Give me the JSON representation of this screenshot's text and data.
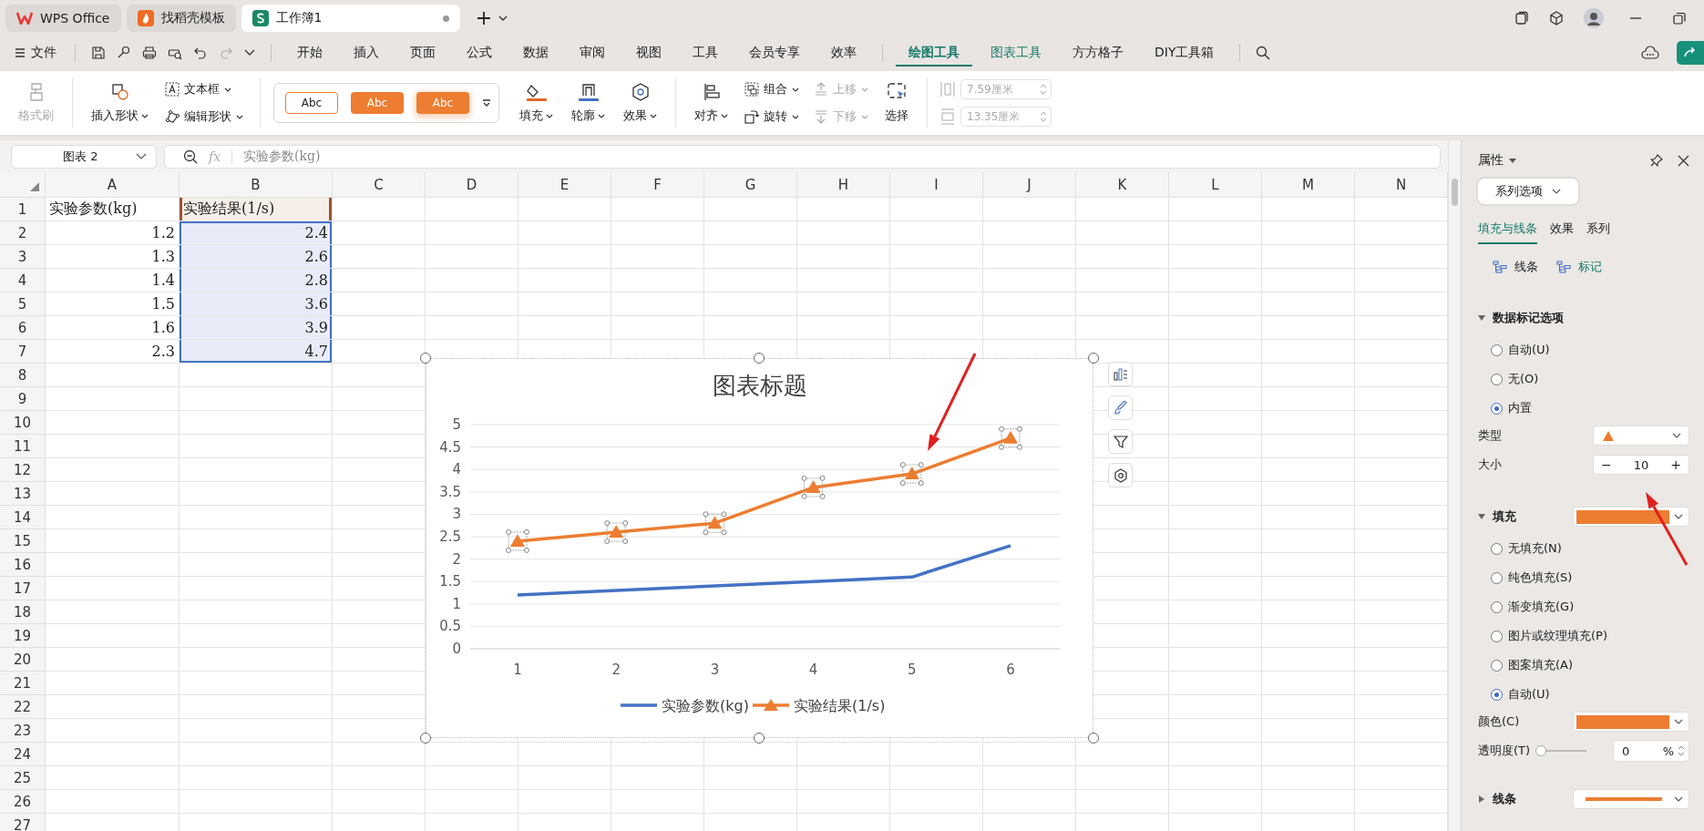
{
  "tabs": [
    {
      "label": "WPS Office",
      "selected": false
    },
    {
      "label": "找稻壳模板",
      "selected": false
    },
    {
      "label": "工作簿1",
      "selected": true
    }
  ],
  "menu": {
    "file": "文件",
    "items": [
      {
        "label": "开始",
        "selected": false,
        "contextual": false
      },
      {
        "label": "插入",
        "selected": false,
        "contextual": false
      },
      {
        "label": "页面",
        "selected": false,
        "contextual": false
      },
      {
        "label": "公式",
        "selected": false,
        "contextual": false
      },
      {
        "label": "数据",
        "selected": false,
        "contextual": false
      },
      {
        "label": "审阅",
        "selected": false,
        "contextual": false
      },
      {
        "label": "视图",
        "selected": false,
        "contextual": false
      },
      {
        "label": "工具",
        "selected": false,
        "contextual": false
      },
      {
        "label": "会员专享",
        "selected": false,
        "contextual": false
      },
      {
        "label": "效率",
        "selected": false,
        "contextual": false
      },
      {
        "label": "绘图工具",
        "selected": true,
        "contextual": true
      },
      {
        "label": "图表工具",
        "selected": false,
        "contextual": true
      },
      {
        "label": "方方格子",
        "selected": false,
        "contextual": false
      },
      {
        "label": "DIY工具箱",
        "selected": false,
        "contextual": false
      }
    ]
  },
  "ribbon": {
    "format_painter": {
      "label": "格式刷",
      "disabled": true
    },
    "insert_shape": "插入形状",
    "text_box": "文本框",
    "edit_shape": "编辑形状",
    "styles": [
      {
        "label": "Abc",
        "kind": "outline"
      },
      {
        "label": "Abc",
        "kind": "filled"
      },
      {
        "label": "Abc",
        "kind": "glow"
      }
    ],
    "fill": "填充",
    "outline": "轮廓",
    "effect": "效果",
    "align": "对齐",
    "group": "组合",
    "rotate": "旋转",
    "bring_forward": {
      "label": "上移",
      "disabled": true
    },
    "send_backward": {
      "label": "下移",
      "disabled": true
    },
    "select": "选择",
    "height": {
      "value": "7.59厘米",
      "disabled": true
    },
    "width": {
      "value": "13.35厘米",
      "disabled": true
    }
  },
  "formula_bar": {
    "name_box": "图表 2",
    "fx": "fx",
    "content": "实验参数(kg)"
  },
  "sheet": {
    "columns": [
      "A",
      "B",
      "C",
      "D",
      "E",
      "F",
      "G",
      "H",
      "I",
      "J",
      "K",
      "L",
      "M",
      "N"
    ],
    "row_labels": [
      "1",
      "2",
      "3",
      "4",
      "5",
      "6",
      "7",
      "8",
      "9",
      "10",
      "11",
      "12",
      "13",
      "14",
      "15",
      "16",
      "17",
      "18",
      "19",
      "20",
      "21",
      "22",
      "23",
      "24",
      "25",
      "26",
      "27"
    ],
    "rows": [
      [
        {
          "text": "实验参数(kg)",
          "highlighted": false
        },
        {
          "text": "实验结果(1/s)",
          "highlighted": true
        }
      ],
      [
        {
          "text": "1.2",
          "highlighted": false
        },
        {
          "text": "2.4",
          "highlighted": true
        }
      ],
      [
        {
          "text": "1.3",
          "highlighted": false
        },
        {
          "text": "2.6",
          "highlighted": true
        }
      ],
      [
        {
          "text": "1.4",
          "highlighted": false
        },
        {
          "text": "2.8",
          "highlighted": true
        }
      ],
      [
        {
          "text": "1.5",
          "highlighted": false
        },
        {
          "text": "3.6",
          "highlighted": true
        }
      ],
      [
        {
          "text": "1.6",
          "highlighted": false
        },
        {
          "text": "3.9",
          "highlighted": true
        }
      ],
      [
        {
          "text": "2.3",
          "highlighted": false
        },
        {
          "text": "4.7",
          "highlighted": true
        }
      ]
    ]
  },
  "chart": {
    "markers_selected": true,
    "chart_data": {
      "type": "line",
      "title": "图表标题",
      "categories": [
        "1",
        "2",
        "3",
        "4",
        "5",
        "6"
      ],
      "series": [
        {
          "name": "实验参数(kg)",
          "color": "#4472c4",
          "marker": "none",
          "values": [
            1.2,
            1.3,
            1.4,
            1.5,
            1.6,
            2.3
          ]
        },
        {
          "name": "实验结果(1/s)",
          "color": "#ed7d31",
          "marker": "triangle",
          "values": [
            2.4,
            2.6,
            2.8,
            3.6,
            3.9,
            4.7
          ]
        }
      ],
      "ylim": [
        0,
        5
      ],
      "yticks": [
        0,
        0.5,
        1,
        1.5,
        2,
        2.5,
        3,
        3.5,
        4,
        4.5,
        5
      ],
      "grid": true,
      "legend": "bottom"
    }
  },
  "panel": {
    "title": "属性",
    "series_dropdown": "系列选项",
    "tabs": [
      {
        "label": "填充与线条",
        "selected": true
      },
      {
        "label": "效果",
        "selected": false
      },
      {
        "label": "系列",
        "selected": false
      }
    ],
    "subtabs": [
      {
        "label": "线条",
        "selected": false
      },
      {
        "label": "标记",
        "selected": true
      }
    ],
    "marker_section": {
      "title": "数据标记选项",
      "expanded": true,
      "options": [
        {
          "label": "自动(U)",
          "selected": false
        },
        {
          "label": "无(O)",
          "selected": false
        },
        {
          "label": "内置",
          "selected": true
        }
      ],
      "type_label": "类型",
      "type_marker": {
        "color": "#ed7d31"
      },
      "size_label": "大小",
      "size_minus": "−",
      "size": "10",
      "size_plus": "+"
    },
    "fill_section": {
      "title": "填充",
      "expanded": true,
      "swatch": {
        "color": "#ed7d31"
      },
      "options": [
        {
          "label": "无填充(N)",
          "selected": false
        },
        {
          "label": "纯色填充(S)",
          "selected": false
        },
        {
          "label": "渐变填充(G)",
          "selected": false
        },
        {
          "label": "图片或纹理填充(P)",
          "selected": false
        },
        {
          "label": "图案填充(A)",
          "selected": false
        },
        {
          "label": "自动(U)",
          "selected": true
        }
      ],
      "color_label": "颜色(C)",
      "color_swatch": {
        "color": "#ed7d31"
      },
      "transparency_label": "透明度(T)",
      "transparency": {
        "level": 0
      },
      "transparency_value": "0",
      "percent": "%"
    },
    "line_section": {
      "title": "线条",
      "expanded": false,
      "swatch": {
        "color": "#ed7d31"
      }
    }
  }
}
